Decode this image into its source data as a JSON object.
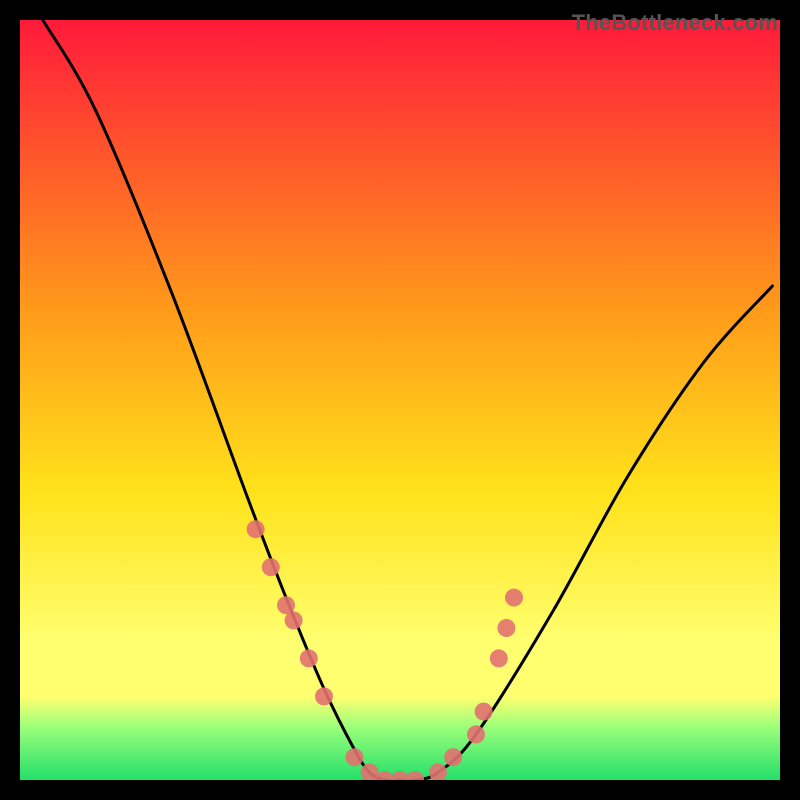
{
  "watermark": "TheBottleneck.com",
  "colors": {
    "top": "#ff1a3a",
    "mid1": "#ff9a1a",
    "mid2": "#ffe21a",
    "mid3": "#ffff70",
    "green1": "#9cff7a",
    "green2": "#23e06a",
    "curve": "#000000",
    "marker": "#e27170",
    "bg": "#000000"
  },
  "chart_data": {
    "type": "line",
    "title": "",
    "xlabel": "",
    "ylabel": "",
    "xlim": [
      0,
      100
    ],
    "ylim": [
      0,
      100
    ],
    "series": [
      {
        "name": "curve",
        "x": [
          3,
          10,
          20,
          30,
          35,
          40,
          44,
          46,
          48,
          50,
          52,
          55,
          60,
          70,
          80,
          90,
          99
        ],
        "values": [
          100,
          88,
          64,
          37,
          24,
          12,
          4,
          1,
          0,
          0,
          0,
          1,
          6,
          22,
          40,
          55,
          65
        ]
      }
    ],
    "markers": {
      "name": "points",
      "x": [
        31,
        33,
        35,
        36,
        38,
        40,
        44,
        46,
        48,
        50,
        52,
        55,
        57,
        60,
        61,
        63,
        64,
        65
      ],
      "values": [
        33,
        28,
        23,
        21,
        16,
        11,
        3,
        1,
        0,
        0,
        0,
        1,
        3,
        6,
        9,
        16,
        20,
        24
      ]
    }
  }
}
